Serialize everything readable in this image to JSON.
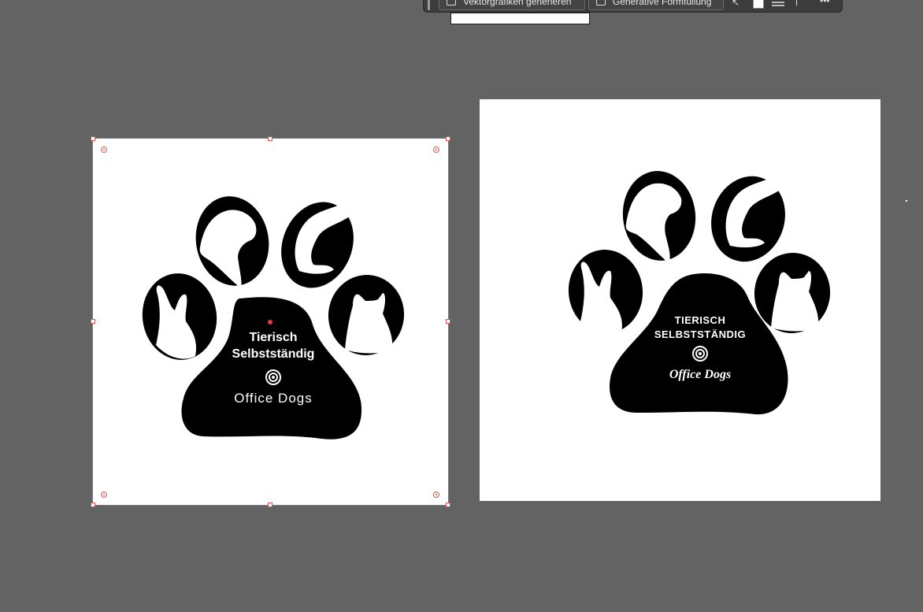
{
  "toolbar": {
    "vectorize_label": "Vektorgrafiken generieren",
    "generative_fill_label": "Generative Formfüllung",
    "more_label": "•••"
  },
  "logo_left": {
    "line1": "Tierisch",
    "line2": "Selbstständig",
    "brand": "Office Dogs"
  },
  "logo_right": {
    "line1": "TIERISCH",
    "line2": "SELBSTSTÄNDIG",
    "brand": "Office Dogs"
  },
  "colors": {
    "canvas": "#636363",
    "selection": "#d9534f",
    "ink": "#000000",
    "paper": "#ffffff"
  }
}
